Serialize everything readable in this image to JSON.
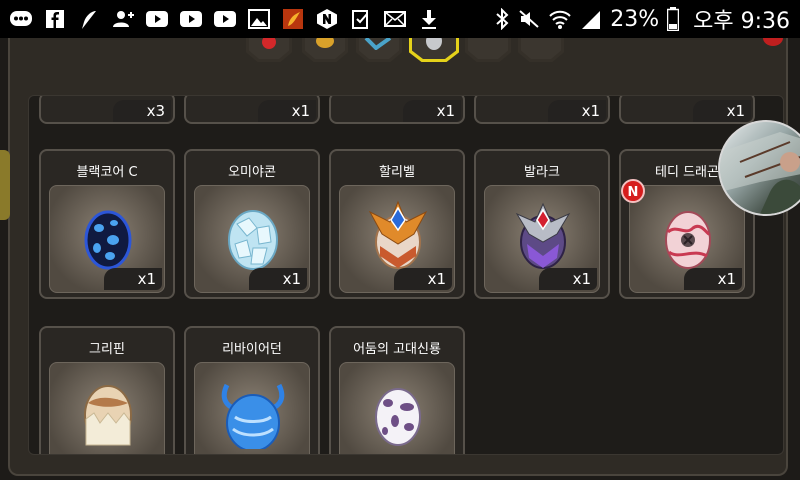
{
  "status_bar": {
    "battery": "23%",
    "time": "오후 9:36",
    "notification_icons": [
      "messenger-icon",
      "facebook-icon",
      "feather-icon",
      "person-add-icon",
      "youtube-icon",
      "youtube-icon",
      "youtube-icon",
      "image-icon",
      "game-icon",
      "naver-icon",
      "clipboard-icon",
      "mail-icon",
      "download-icon"
    ],
    "system_icons": [
      "bluetooth-icon",
      "mute-icon",
      "wifi-icon",
      "signal-icon",
      "battery-icon"
    ]
  },
  "top_row": [
    {
      "qty": "x3"
    },
    {
      "qty": "x1"
    },
    {
      "qty": "x1"
    },
    {
      "qty": "x1"
    },
    {
      "qty": "x1"
    }
  ],
  "eggs_row1": [
    {
      "name": "블랙코어 C",
      "qty": "x1"
    },
    {
      "name": "오미야콘",
      "qty": "x1"
    },
    {
      "name": "할리벨",
      "qty": "x1"
    },
    {
      "name": "발라크",
      "qty": "x1"
    },
    {
      "name": "테디 드래곤",
      "qty": "x1",
      "badge": "N"
    }
  ],
  "eggs_row2": [
    {
      "name": "그리핀"
    },
    {
      "name": "리바이어던"
    },
    {
      "name": "어둠의 고대신룡"
    }
  ],
  "colors": {
    "selected_tab": "#e5d21a",
    "new_badge": "#d61d1d",
    "panel": "#2f2b25"
  }
}
